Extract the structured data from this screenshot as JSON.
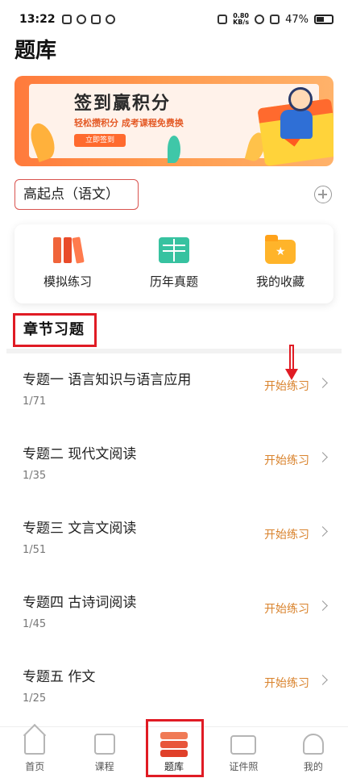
{
  "status_bar": {
    "time": "13:22",
    "net_speed_value": "0.80",
    "net_speed_unit": "KB/s",
    "battery": "47%"
  },
  "page": {
    "title": "题库"
  },
  "banner": {
    "title": "签到赢积分",
    "subtitle": "轻松攒积分 成考课程免费换",
    "button": "立即签到"
  },
  "subject": {
    "current": "高起点（语文）"
  },
  "quick_actions": [
    {
      "label": "模拟练习",
      "icon": "books-icon"
    },
    {
      "label": "历年真题",
      "icon": "open-book-icon"
    },
    {
      "label": "我的收藏",
      "icon": "star-folder-icon"
    }
  ],
  "section": {
    "title": "章节习题"
  },
  "topics": [
    {
      "name": "专题一 语言知识与语言应用",
      "count": "1/71",
      "action": "开始练习"
    },
    {
      "name": "专题二 现代文阅读",
      "count": "1/35",
      "action": "开始练习"
    },
    {
      "name": "专题三 文言文阅读",
      "count": "1/51",
      "action": "开始练习"
    },
    {
      "name": "专题四 古诗词阅读",
      "count": "1/45",
      "action": "开始练习"
    },
    {
      "name": "专题五 作文",
      "count": "1/25",
      "action": "开始练习"
    }
  ],
  "bottom_nav": [
    {
      "label": "首页",
      "icon": "home-icon"
    },
    {
      "label": "课程",
      "icon": "course-icon"
    },
    {
      "label": "题库",
      "icon": "question-bank-icon",
      "active": true
    },
    {
      "label": "证件照",
      "icon": "id-photo-icon"
    },
    {
      "label": "我的",
      "icon": "user-icon"
    }
  ],
  "colors": {
    "accent_orange": "#d9822b",
    "highlight_red": "#e01b24",
    "banner_orange": "#ff7a3c"
  }
}
